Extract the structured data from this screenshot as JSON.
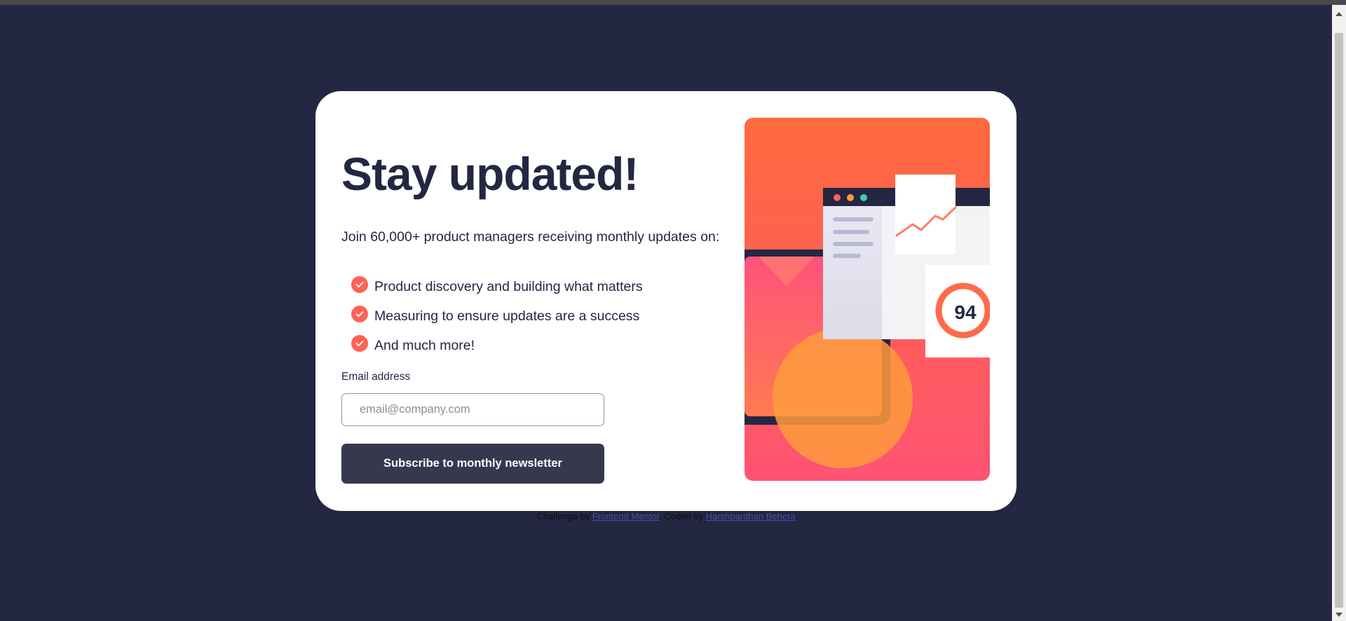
{
  "card": {
    "headline": "Stay updated!",
    "intro": "Join 60,000+ product managers receiving monthly updates on:",
    "benefits": [
      {
        "icon": "check-icon",
        "text": "Product discovery and building what matters"
      },
      {
        "icon": "check-icon",
        "text": "Measuring to ensure updates are a success"
      },
      {
        "icon": "check-icon",
        "text": "And much more!"
      }
    ],
    "form": {
      "email_label": "Email address",
      "email_placeholder": "email@company.com",
      "email_value": "",
      "submit_label": "Subscribe to monthly newsletter"
    },
    "illustration": {
      "score": "94"
    }
  },
  "footer": {
    "challenge_prefix": "Challenge by",
    "challenge_link": "Frontend Mentor",
    "coded_prefix": ". Coded by",
    "author_link": "Harshbardhan Behera"
  },
  "colors": {
    "background": "#242742",
    "card": "#ffffff",
    "accent": "#ff6257",
    "button": "#36384e",
    "text": "#242742"
  }
}
